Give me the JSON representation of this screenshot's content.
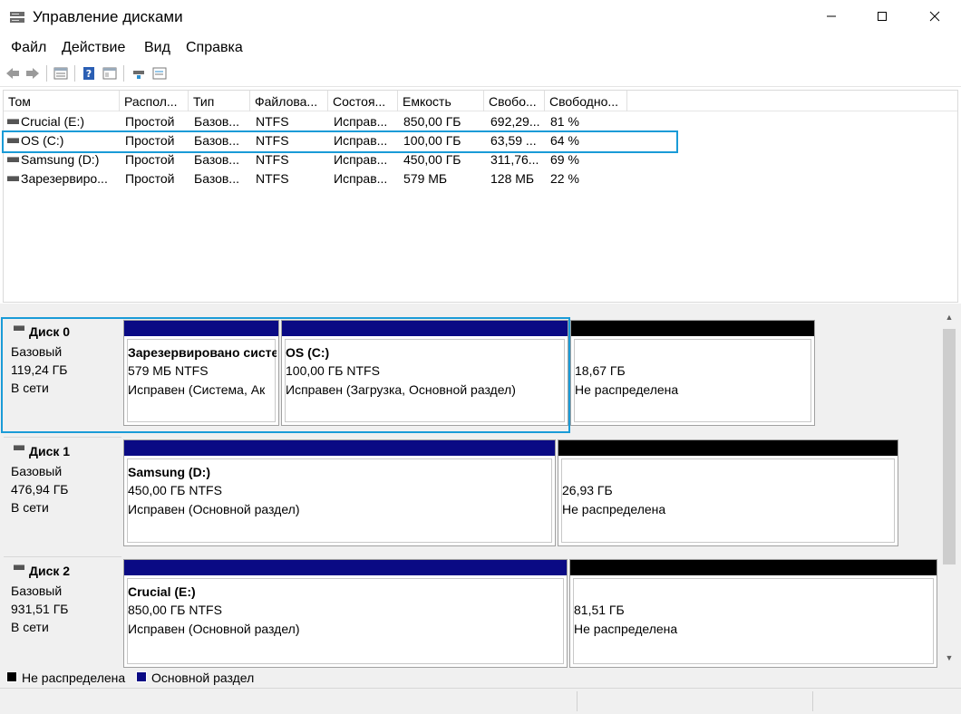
{
  "window": {
    "title": "Управление дисками",
    "minimize": "—",
    "maximize": "☐",
    "close": "✕"
  },
  "menu": [
    "Файл",
    "Действие",
    "Вид",
    "Справка"
  ],
  "toolbar": {
    "icons": [
      "back-icon",
      "forward-icon",
      "list-view-icon",
      "help-icon",
      "properties-icon",
      "connect-icon",
      "settings-icon"
    ]
  },
  "volume_list": {
    "columns": [
      "Том",
      "Распол...",
      "Тип",
      "Файлова...",
      "Состоя...",
      "Емкость",
      "Свобо...",
      "Свободно..."
    ],
    "rows": [
      [
        "Crucial (E:)",
        "Простой",
        "Базов...",
        "NTFS",
        "Исправ...",
        "850,00 ГБ",
        "692,29...",
        "81 %"
      ],
      [
        "OS (C:)",
        "Простой",
        "Базов...",
        "NTFS",
        "Исправ...",
        "100,00 ГБ",
        "63,59 ...",
        "64 %"
      ],
      [
        "Samsung (D:)",
        "Простой",
        "Базов...",
        "NTFS",
        "Исправ...",
        "450,00 ГБ",
        "311,76...",
        "69 %"
      ],
      [
        "Зарезервиро...",
        "Простой",
        "Базов...",
        "NTFS",
        "Исправ...",
        "579 МБ",
        "128 МБ",
        "22 %"
      ]
    ]
  },
  "disks": [
    {
      "name": "Диск 0",
      "type": "Базовый",
      "size": "119,24 ГБ",
      "status": "В сети",
      "partitions": [
        {
          "title": "Зарезервировано систе",
          "size": "579 МБ NTFS",
          "status": "Исправен (Система, Ак"
        },
        {
          "title": "OS  (C:)",
          "size": "100,00 ГБ NTFS",
          "status": "Исправен (Загрузка, Основной раздел)"
        },
        {
          "title": "",
          "size": "18,67 ГБ",
          "status": "Не распределена"
        }
      ]
    },
    {
      "name": "Диск 1",
      "type": "Базовый",
      "size": "476,94 ГБ",
      "status": "В сети",
      "partitions": [
        {
          "title": "Samsung  (D:)",
          "size": "450,00 ГБ NTFS",
          "status": "Исправен (Основной раздел)"
        },
        {
          "title": "",
          "size": "26,93 ГБ",
          "status": "Не распределена"
        }
      ]
    },
    {
      "name": "Диск 2",
      "type": "Базовый",
      "size": "931,51 ГБ",
      "status": "В сети",
      "partitions": [
        {
          "title": "Crucial  (E:)",
          "size": "850,00 ГБ NTFS",
          "status": "Исправен (Основной раздел)"
        },
        {
          "title": "",
          "size": "81,51 ГБ",
          "status": "Не распределена"
        }
      ]
    }
  ],
  "legend": [
    {
      "label": "Не распределена",
      "color": "#000000"
    },
    {
      "label": "Основной раздел",
      "color": "#0a0a84"
    }
  ],
  "colors": {
    "primary_partition": "#0a0a84",
    "unallocated": "#000000",
    "highlight": "#1a9bd7"
  }
}
